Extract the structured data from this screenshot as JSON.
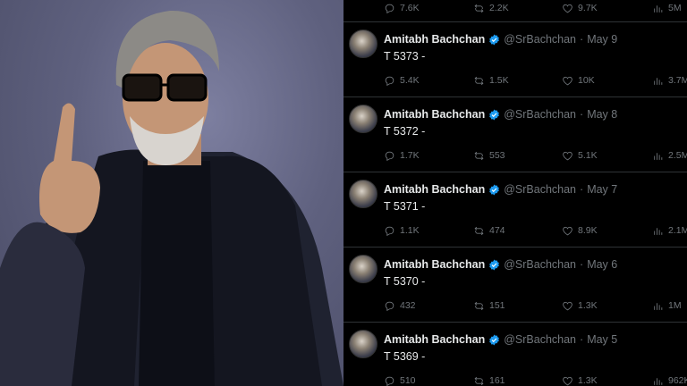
{
  "top_metrics": {
    "replies": "7.6K",
    "reposts": "2.2K",
    "likes": "9.7K",
    "views": "5M"
  },
  "tweets": [
    {
      "name": "Amitabh Bachchan",
      "handle": "@SrBachchan",
      "separator": "·",
      "date": "May 9",
      "text": "T 5373 -",
      "replies": "5.4K",
      "reposts": "1.5K",
      "likes": "10K",
      "views": "3.7M"
    },
    {
      "name": "Amitabh Bachchan",
      "handle": "@SrBachchan",
      "separator": "·",
      "date": "May 8",
      "text": "T 5372 -",
      "replies": "1.7K",
      "reposts": "553",
      "likes": "5.1K",
      "views": "2.5M"
    },
    {
      "name": "Amitabh Bachchan",
      "handle": "@SrBachchan",
      "separator": "·",
      "date": "May 7",
      "text": "T 5371 -",
      "replies": "1.1K",
      "reposts": "474",
      "likes": "8.9K",
      "views": "2.1M"
    },
    {
      "name": "Amitabh Bachchan",
      "handle": "@SrBachchan",
      "separator": "·",
      "date": "May 6",
      "text": "T 5370 -",
      "replies": "432",
      "reposts": "151",
      "likes": "1.3K",
      "views": "1M"
    },
    {
      "name": "Amitabh Bachchan",
      "handle": "@SrBachchan",
      "separator": "·",
      "date": "May 5",
      "text": "T 5369 -",
      "replies": "510",
      "reposts": "161",
      "likes": "1.3K",
      "views": "962K"
    }
  ],
  "icons": {
    "reply": "reply-icon",
    "repost": "repost-icon",
    "like": "heart-icon",
    "views": "views-icon",
    "verified": "verified-badge-icon"
  },
  "colors": {
    "background": "#000000",
    "text": "#e7e9ea",
    "muted": "#71767b",
    "verified": "#1d9bf0",
    "divider": "#2f3336"
  }
}
